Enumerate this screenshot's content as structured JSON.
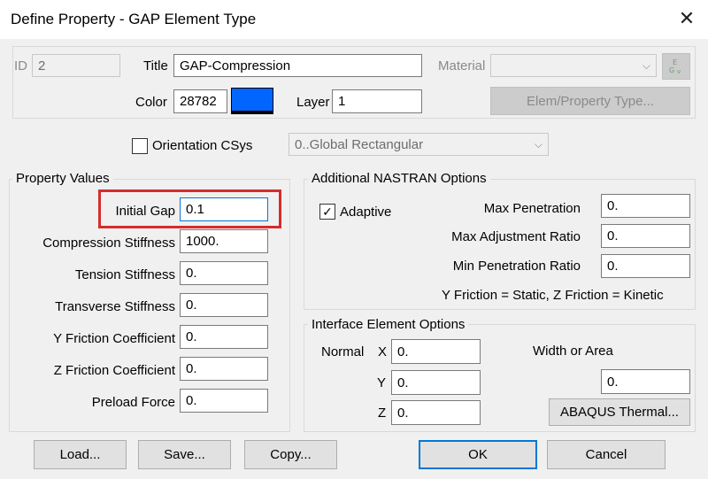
{
  "window": {
    "title": "Define Property - GAP Element Type"
  },
  "header": {
    "id_label": "ID",
    "id_value": "2",
    "title_label": "Title",
    "title_value": "GAP-Compression",
    "material_label": "Material",
    "material_value": "",
    "color_label": "Color",
    "color_value": "28782",
    "color_swatch": "#0066ff",
    "layer_label": "Layer",
    "layer_value": "1",
    "elem_type_button": "Elem/Property Type..."
  },
  "orientation": {
    "label": "Orientation CSys",
    "checked": false,
    "value": "0..Global Rectangular"
  },
  "property_values": {
    "group_label": "Property Values",
    "fields": [
      {
        "label": "Initial Gap",
        "value": "0.1"
      },
      {
        "label": "Compression Stiffness",
        "value": "1000."
      },
      {
        "label": "Tension Stiffness",
        "value": "0."
      },
      {
        "label": "Transverse Stiffness",
        "value": "0."
      },
      {
        "label": "Y Friction Coefficient",
        "value": "0."
      },
      {
        "label": "Z Friction Coefficient",
        "value": "0."
      },
      {
        "label": "Preload Force",
        "value": "0."
      }
    ]
  },
  "nastran": {
    "group_label": "Additional NASTRAN Options",
    "adaptive_label": "Adaptive",
    "adaptive_checked": true,
    "max_penetration_label": "Max Penetration",
    "max_penetration_value": "0.",
    "max_adjustment_label": "Max Adjustment Ratio",
    "max_adjustment_value": "0.",
    "min_penetration_label": "Min Penetration Ratio",
    "min_penetration_value": "0.",
    "friction_note": "Y Friction = Static, Z Friction = Kinetic"
  },
  "interface": {
    "group_label": "Interface Element Options",
    "normal_label": "Normal",
    "x_label": "X",
    "x_value": "0.",
    "y_label": "Y",
    "y_value": "0.",
    "z_label": "Z",
    "z_value": "0.",
    "width_area_label": "Width or Area",
    "width_area_value": "0.",
    "abaqus_button": "ABAQUS Thermal..."
  },
  "footer": {
    "load": "Load...",
    "save": "Save...",
    "copy": "Copy...",
    "ok": "OK",
    "cancel": "Cancel"
  },
  "colors": {
    "highlight": "#d62c2c",
    "default_button_border": "#0078d7"
  }
}
